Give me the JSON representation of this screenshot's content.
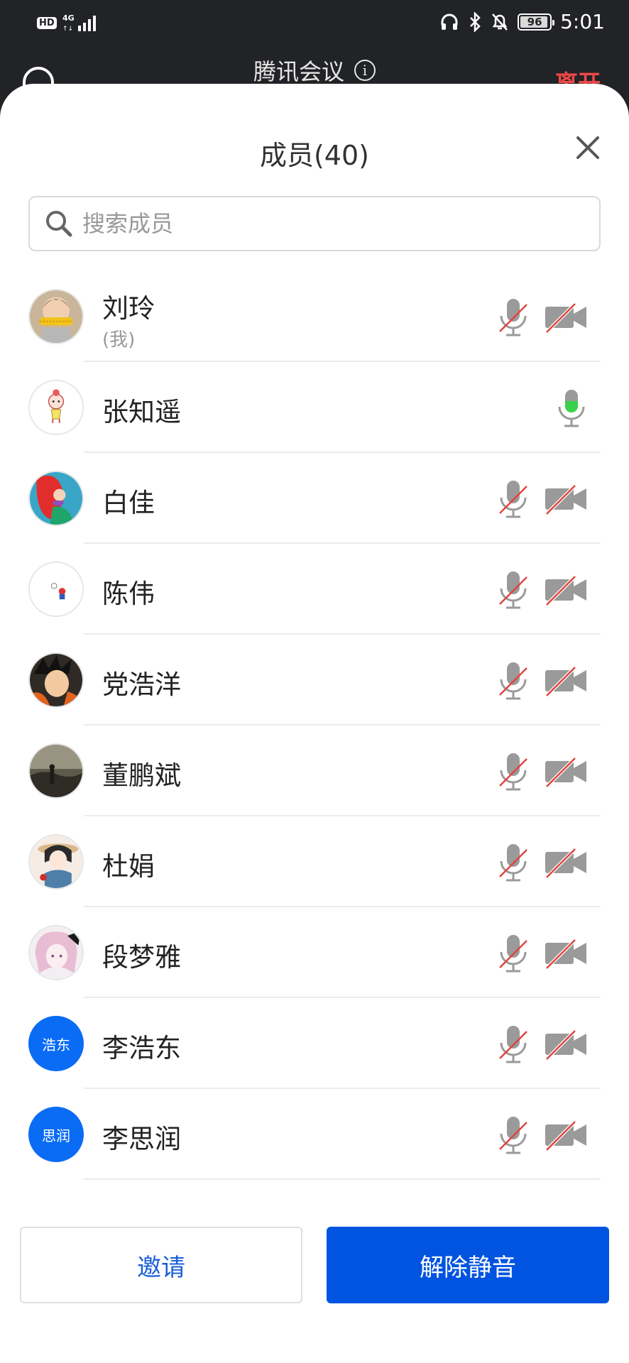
{
  "status_bar": {
    "hd_label": "HD",
    "network_label": "4G",
    "battery_level": "96",
    "battery_fraction": 0.96,
    "time": "5:01"
  },
  "meeting": {
    "title": "腾讯会议",
    "leave_label": "离开"
  },
  "panel": {
    "title": "成员(40)",
    "search_placeholder": "搜索成员"
  },
  "members": [
    {
      "name": "刘玲",
      "sub": "(我)",
      "mic": "muted",
      "camera": "off",
      "avatar": "photo-girl-corn"
    },
    {
      "name": "张知遥",
      "sub": "",
      "mic": "speaking",
      "camera": "none",
      "avatar": "cartoon-girl"
    },
    {
      "name": "白佳",
      "sub": "",
      "mic": "muted",
      "camera": "off",
      "avatar": "mermaid"
    },
    {
      "name": "陈伟",
      "sub": "",
      "mic": "muted",
      "camera": "off",
      "avatar": "small-cartoon"
    },
    {
      "name": "党浩洋",
      "sub": "",
      "mic": "muted",
      "camera": "off",
      "avatar": "anime-goku"
    },
    {
      "name": "董鹏斌",
      "sub": "",
      "mic": "muted",
      "camera": "off",
      "avatar": "dusk-photo"
    },
    {
      "name": "杜娟",
      "sub": "",
      "mic": "muted",
      "camera": "off",
      "avatar": "snow-white"
    },
    {
      "name": "段梦雅",
      "sub": "",
      "mic": "muted",
      "camera": "off",
      "avatar": "anime-girl"
    },
    {
      "name": "李浩东",
      "sub": "",
      "mic": "muted",
      "camera": "off",
      "avatar_text": "浩东"
    },
    {
      "name": "李思润",
      "sub": "",
      "mic": "muted",
      "camera": "off",
      "avatar_text": "思润"
    }
  ],
  "buttons": {
    "invite": "邀请",
    "unmute_all": "解除静音"
  },
  "colors": {
    "primary": "#0054e0",
    "link": "#1a5fd6",
    "danger": "#f04848",
    "avatar_blue": "#0a6cf5",
    "speaking_green": "#3ad24a"
  }
}
